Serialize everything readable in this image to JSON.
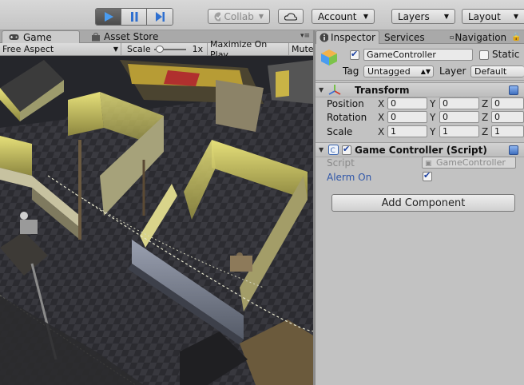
{
  "toolbar": {
    "play_icon": "play-icon",
    "pause_icon": "pause-icon",
    "step_icon": "step-icon",
    "collab_label": "Collab",
    "cloud_icon": "cloud-icon",
    "account_label": "Account",
    "layers_label": "Layers",
    "layout_label": "Layout"
  },
  "tabs": {
    "game": "Game",
    "asset_store": "Asset Store"
  },
  "game_bar": {
    "aspect": "Free Aspect",
    "scale_label": "Scale",
    "scale_value": "1x",
    "maximize": "Maximize On Play",
    "mute": "Mute"
  },
  "inspector": {
    "tabs": {
      "inspector": "Inspector",
      "services": "Services",
      "navigation": "Navigation"
    },
    "object": {
      "name": "GameController",
      "active": true,
      "static_label": "Static",
      "tag_label": "Tag",
      "tag_value": "Untagged",
      "layer_label": "Layer",
      "layer_value": "Default"
    },
    "transform": {
      "title": "Transform",
      "position_label": "Position",
      "rotation_label": "Rotation",
      "scale_label": "Scale",
      "x_label": "X",
      "y_label": "Y",
      "z_label": "Z",
      "position": {
        "x": "0",
        "y": "0",
        "z": "0"
      },
      "rotation": {
        "x": "0",
        "y": "0",
        "z": "0"
      },
      "scale": {
        "x": "1",
        "y": "1",
        "z": "1"
      }
    },
    "script_component": {
      "title": "Game Controller (Script)",
      "enabled": true,
      "script_label": "Script",
      "script_value": "GameController",
      "alerm_label": "Alerm On",
      "alerm_on": true
    },
    "add_component": "Add Component"
  },
  "colors": {
    "play_active": "#4a8fe0",
    "inspector_bg": "#c2c2c2",
    "link_blue": "#2f56a8"
  }
}
